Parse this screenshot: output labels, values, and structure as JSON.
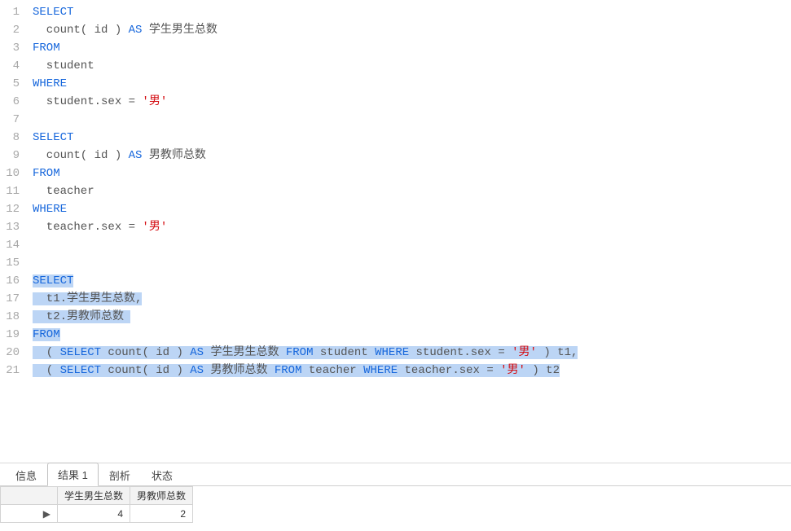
{
  "editor": {
    "lines": [
      {
        "n": 1,
        "sel": false,
        "tokens": [
          {
            "c": "kw",
            "t": "SELECT"
          }
        ]
      },
      {
        "n": 2,
        "sel": false,
        "tokens": [
          {
            "c": "txt",
            "t": "  count( id ) "
          },
          {
            "c": "kw",
            "t": "AS"
          },
          {
            "c": "txt",
            "t": " 学生男生总数"
          }
        ]
      },
      {
        "n": 3,
        "sel": false,
        "tokens": [
          {
            "c": "kw",
            "t": "FROM"
          }
        ]
      },
      {
        "n": 4,
        "sel": false,
        "tokens": [
          {
            "c": "txt",
            "t": "  student "
          }
        ]
      },
      {
        "n": 5,
        "sel": false,
        "tokens": [
          {
            "c": "kw",
            "t": "WHERE"
          }
        ]
      },
      {
        "n": 6,
        "sel": false,
        "tokens": [
          {
            "c": "txt",
            "t": "  student.sex = "
          },
          {
            "c": "str",
            "t": "'男'"
          }
        ]
      },
      {
        "n": 7,
        "sel": false,
        "tokens": [
          {
            "c": "txt",
            "t": "  "
          }
        ]
      },
      {
        "n": 8,
        "sel": false,
        "tokens": [
          {
            "c": "kw",
            "t": "SELECT"
          }
        ]
      },
      {
        "n": 9,
        "sel": false,
        "tokens": [
          {
            "c": "txt",
            "t": "  count( id ) "
          },
          {
            "c": "kw",
            "t": "AS"
          },
          {
            "c": "txt",
            "t": " 男教师总数"
          }
        ]
      },
      {
        "n": 10,
        "sel": false,
        "tokens": [
          {
            "c": "kw",
            "t": "FROM"
          }
        ]
      },
      {
        "n": 11,
        "sel": false,
        "tokens": [
          {
            "c": "txt",
            "t": "  teacher "
          }
        ]
      },
      {
        "n": 12,
        "sel": false,
        "tokens": [
          {
            "c": "kw",
            "t": "WHERE"
          }
        ]
      },
      {
        "n": 13,
        "sel": false,
        "tokens": [
          {
            "c": "txt",
            "t": "  teacher.sex = "
          },
          {
            "c": "str",
            "t": "'男'"
          }
        ]
      },
      {
        "n": 14,
        "sel": false,
        "tokens": [
          {
            "c": "txt",
            "t": "  "
          }
        ]
      },
      {
        "n": 15,
        "sel": false,
        "tokens": [
          {
            "c": "txt",
            "t": "  "
          }
        ]
      },
      {
        "n": 16,
        "sel": true,
        "tokens": [
          {
            "c": "kw",
            "t": "SELECT"
          }
        ]
      },
      {
        "n": 17,
        "sel": true,
        "tokens": [
          {
            "c": "txt",
            "t": "  t1.学生男生总数,"
          }
        ]
      },
      {
        "n": 18,
        "sel": true,
        "tokens": [
          {
            "c": "txt",
            "t": "  t2.男教师总数 "
          }
        ]
      },
      {
        "n": 19,
        "sel": true,
        "tokens": [
          {
            "c": "kw",
            "t": "FROM"
          }
        ]
      },
      {
        "n": 20,
        "sel": true,
        "tokens": [
          {
            "c": "txt",
            "t": "  ( "
          },
          {
            "c": "kw",
            "t": "SELECT"
          },
          {
            "c": "txt",
            "t": " count( id ) "
          },
          {
            "c": "kw",
            "t": "AS"
          },
          {
            "c": "txt",
            "t": " 学生男生总数 "
          },
          {
            "c": "kw",
            "t": "FROM"
          },
          {
            "c": "txt",
            "t": " student "
          },
          {
            "c": "kw",
            "t": "WHERE"
          },
          {
            "c": "txt",
            "t": " student.sex = "
          },
          {
            "c": "str",
            "t": "'男'"
          },
          {
            "c": "txt",
            "t": " ) t1,"
          }
        ]
      },
      {
        "n": 21,
        "sel": true,
        "tokens": [
          {
            "c": "txt",
            "t": "  ( "
          },
          {
            "c": "kw",
            "t": "SELECT"
          },
          {
            "c": "txt",
            "t": " count( id ) "
          },
          {
            "c": "kw",
            "t": "AS"
          },
          {
            "c": "txt",
            "t": " 男教师总数 "
          },
          {
            "c": "kw",
            "t": "FROM"
          },
          {
            "c": "txt",
            "t": " teacher "
          },
          {
            "c": "kw",
            "t": "WHERE"
          },
          {
            "c": "txt",
            "t": " teacher.sex = "
          },
          {
            "c": "str",
            "t": "'男'"
          },
          {
            "c": "txt",
            "t": " ) t2"
          }
        ]
      }
    ]
  },
  "panel": {
    "tabs": {
      "info": "信息",
      "result1": "结果 1",
      "profile": "剖析",
      "status": "状态"
    },
    "results": {
      "columns": [
        "学生男生总数",
        "男教师总数"
      ],
      "row_indicator": "▶",
      "rows": [
        [
          "4",
          "2"
        ]
      ]
    }
  }
}
